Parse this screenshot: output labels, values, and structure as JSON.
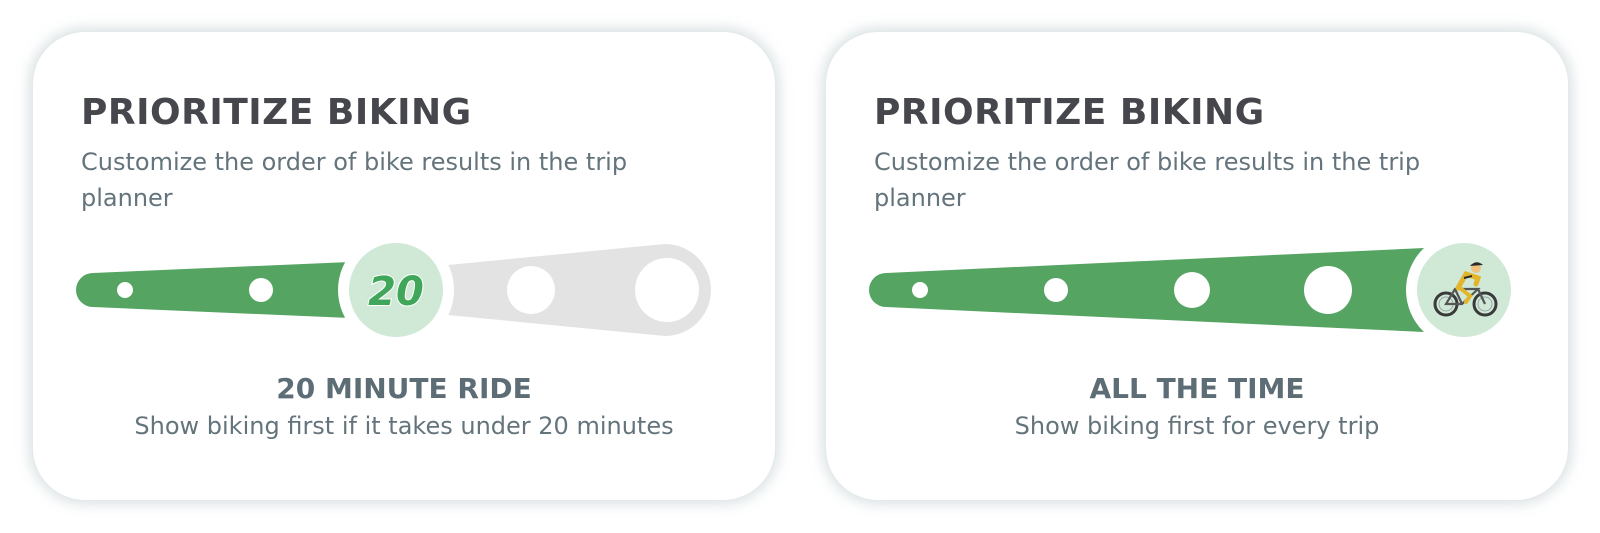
{
  "colors": {
    "track_active": "#55a462",
    "track_inactive": "#e3e3e3",
    "knob_fill": "#cfe9d6",
    "title_text": "#46474c",
    "body_text": "#64747c"
  },
  "cards": [
    {
      "title": "PRIORITIZE BIKING",
      "description": "Customize the order of bike results in the trip planner",
      "slider": {
        "steps": 5,
        "selected_index": 2,
        "knob_content": "20",
        "knob_type": "text"
      },
      "setting_title": "20 MINUTE RIDE",
      "setting_description": "Show biking first if it takes under 20 minutes"
    },
    {
      "title": "PRIORITIZE BIKING",
      "description": "Customize the order of bike results in the trip planner",
      "slider": {
        "steps": 5,
        "selected_index": 4,
        "knob_content": "cyclist-icon",
        "knob_type": "icon"
      },
      "setting_title": "ALL THE TIME",
      "setting_description": "Show biking first for every trip"
    }
  ]
}
